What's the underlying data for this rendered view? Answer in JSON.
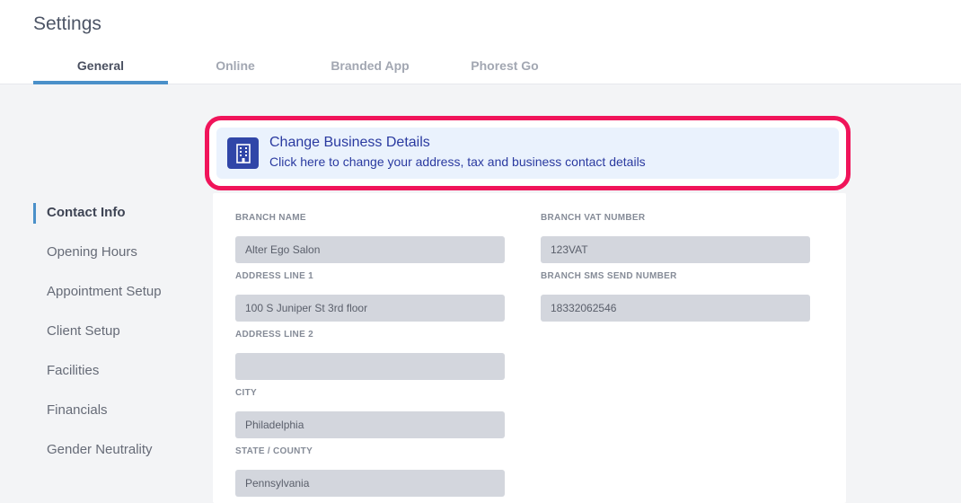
{
  "page": {
    "title": "Settings"
  },
  "tabs": [
    {
      "label": "General",
      "active": true
    },
    {
      "label": "Online"
    },
    {
      "label": "Branded App"
    },
    {
      "label": "Phorest Go"
    }
  ],
  "sidebar": {
    "items": [
      {
        "label": "Contact Info",
        "active": true
      },
      {
        "label": "Opening Hours"
      },
      {
        "label": "Appointment Setup"
      },
      {
        "label": "Client Setup"
      },
      {
        "label": "Facilities"
      },
      {
        "label": "Financials"
      },
      {
        "label": "Gender Neutrality"
      }
    ]
  },
  "banner": {
    "icon": "building-icon",
    "title": "Change Business Details",
    "subtitle": "Click here to change your address, tax and business contact details"
  },
  "form": {
    "branch_name": {
      "label": "BRANCH NAME",
      "value": "Alter Ego Salon"
    },
    "address_line_1": {
      "label": "ADDRESS LINE 1",
      "value": "100 S Juniper St 3rd floor"
    },
    "address_line_2": {
      "label": "ADDRESS LINE 2",
      "value": ""
    },
    "city": {
      "label": "CITY",
      "value": "Philadelphia"
    },
    "state_county": {
      "label": "STATE / COUNTY",
      "value": "Pennsylvania"
    },
    "branch_vat_number": {
      "label": "BRANCH VAT NUMBER",
      "value": "123VAT"
    },
    "branch_sms_send_number": {
      "label": "BRANCH SMS SEND NUMBER",
      "value": "18332062546"
    }
  },
  "colors": {
    "accent": "#4a90c9",
    "highlight": "#f0145a",
    "banner_bg": "#eaf2fd",
    "banner_text": "#2a3aa0",
    "input_bg": "#d3d6dd"
  }
}
